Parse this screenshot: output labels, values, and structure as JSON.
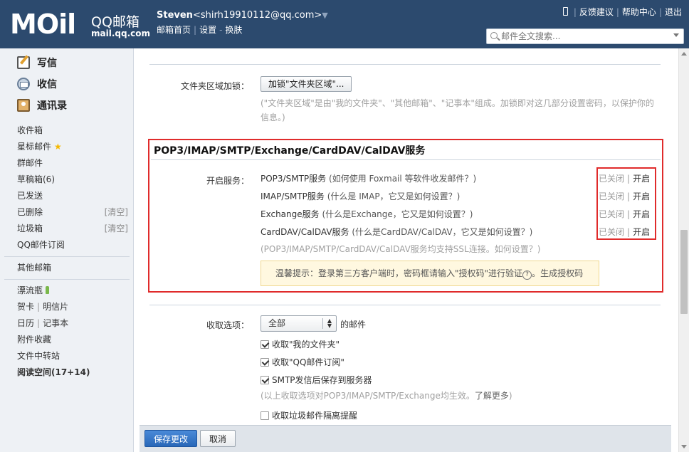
{
  "header": {
    "logo_text": "MOil",
    "brand": "QQ邮箱",
    "domain": "mail.qq.com",
    "user_name": "Steven",
    "user_email": "<shirh19910112@qq.com>",
    "links": [
      "邮箱首页",
      "设置",
      "换肤"
    ],
    "link_sep": "-",
    "top_links": [
      "反馈建议",
      "帮助中心",
      "退出"
    ],
    "search_placeholder": "邮件全文搜索..."
  },
  "sidebar": {
    "compose": "写信",
    "inbox": "收信",
    "contacts": "通讯录",
    "folders": {
      "inbox": "收件箱",
      "starred": "星标邮件",
      "group": "群邮件",
      "drafts": "草稿箱(6)",
      "sent": "已发送",
      "deleted": "已删除",
      "spam": "垃圾箱",
      "clear": "[清空]",
      "subscriptions": "QQ邮件订阅",
      "other_mailbox": "其他邮箱",
      "drift_bottle": "漂流瓶",
      "cards": "贺卡",
      "postcards": "明信片",
      "calendar": "日历",
      "notes": "记事本",
      "attachments": "附件收藏",
      "file_transfer": "文件中转站",
      "reading": "阅读空间(17+14)"
    }
  },
  "main": {
    "folder_lock_label": "文件夹区域加锁：",
    "folder_lock_button": "加锁\"文件夹区域\"...",
    "folder_lock_desc_1": "(\"文件夹区域\"是由\"我的文件夹\"、\"其他邮箱\"、\"记事本\"组成。加锁即对这几部分设置密码，以保护你的",
    "folder_lock_desc_2": "信息。)",
    "section_title": "POP3/IMAP/SMTP/Exchange/CardDAV/CalDAV服务",
    "enable_label": "开启服务：",
    "services": [
      {
        "name": "POP3/SMTP服务",
        "help": "(如何使用 Foxmail 等软件收发邮件？)"
      },
      {
        "name": "IMAP/SMTP服务",
        "help": "(什么是 IMAP，它又是如何设置？)"
      },
      {
        "name": "Exchange服务",
        "help": "(什么是Exchange，它又是如何设置？)"
      },
      {
        "name": "CardDAV/CalDAV服务",
        "help": "(什么是CardDAV/CalDAV，它又是如何设置？)"
      }
    ],
    "status_off": "已关闭",
    "status_sep": "|",
    "status_on": "开启",
    "ssl_note_a": "(POP3/IMAP/SMTP/CardDAV/CalDAV服务均支持SSL连接。",
    "ssl_note_b": "如何设置？",
    "ssl_note_c": ")",
    "tip_text": "温馨提示：登录第三方客户端时，密码框请输入\"授权码\"进行验证",
    "tip_q": "?",
    "tip_dot": "。",
    "tip_link": "生成授权码",
    "receive_label": "收取选项：",
    "receive_select": "全部",
    "receive_suffix": "的邮件",
    "options": [
      {
        "label": "收取\"我的文件夹\"",
        "checked": true
      },
      {
        "label": "收取\"QQ邮件订阅\"",
        "checked": true
      },
      {
        "label": "SMTP发信后保存到服务器",
        "checked": true
      }
    ],
    "options_note_a": "(以上收取选项对POP3/IMAP/SMTP/Exchange均生效。",
    "options_note_b": "了解更多",
    "options_note_c": ")",
    "spam_option": "收取垃圾邮件隔离提醒",
    "save_button": "保存更改",
    "cancel_button": "取消"
  },
  "colors": {
    "header_bg": "#2c4a6e",
    "highlight_red": "#e02b2b",
    "primary_blue": "#2867b8",
    "link_blue": "#3a5ea0"
  }
}
